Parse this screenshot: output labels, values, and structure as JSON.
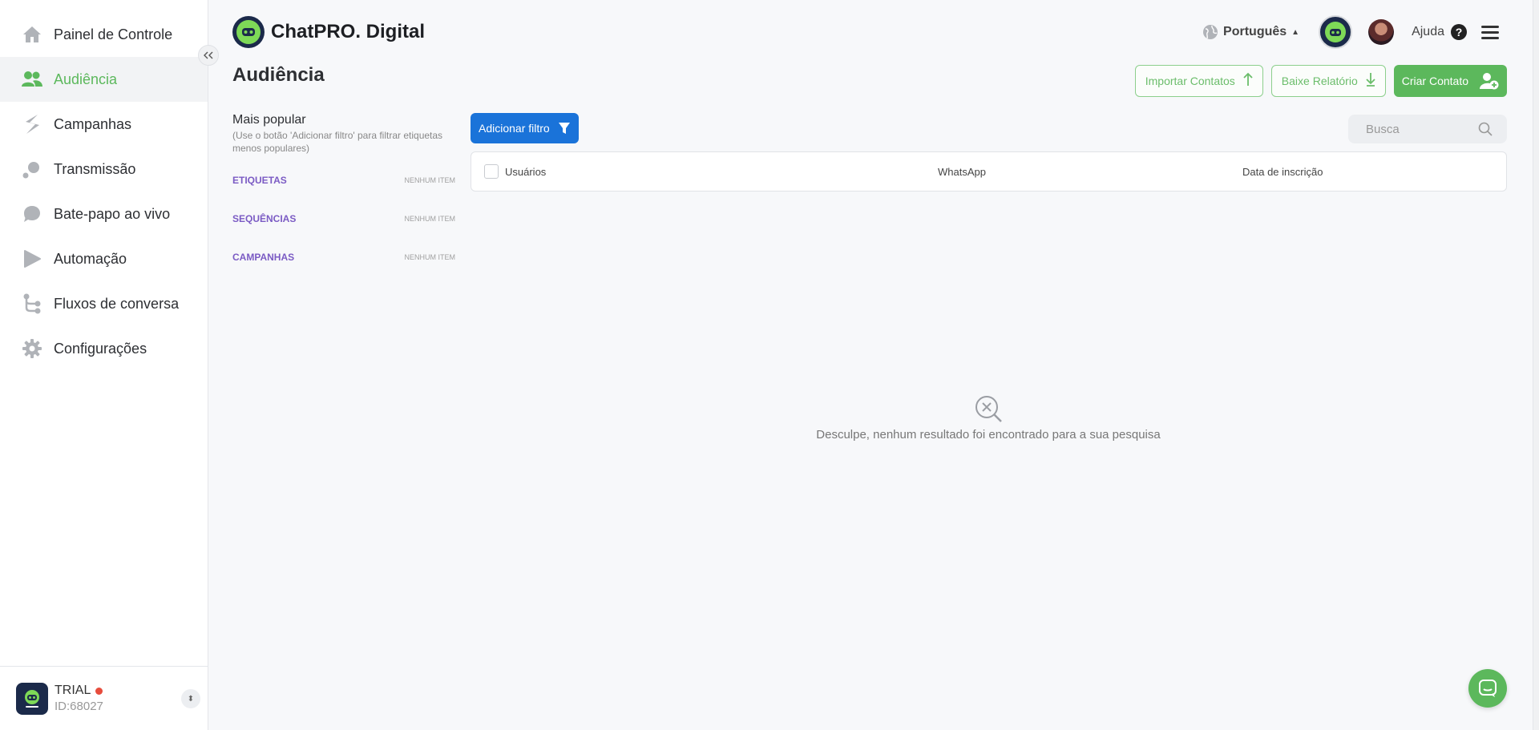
{
  "sidebar": {
    "items": [
      {
        "label": "Painel de Controle",
        "icon": "home-icon",
        "active": false
      },
      {
        "label": "Audiência",
        "icon": "users-icon",
        "active": true
      },
      {
        "label": "Campanhas",
        "icon": "campaign-icon",
        "active": false
      },
      {
        "label": "Transmissão",
        "icon": "broadcast-icon",
        "active": false
      },
      {
        "label": "Bate-papo ao vivo",
        "icon": "chat-icon",
        "active": false
      },
      {
        "label": "Automação",
        "icon": "automation-icon",
        "active": false
      },
      {
        "label": "Fluxos de conversa",
        "icon": "flow-icon",
        "active": false
      },
      {
        "label": "Configurações",
        "icon": "gear-icon",
        "active": false
      }
    ],
    "account": {
      "plan": "TRIAL",
      "id": "ID:68027"
    }
  },
  "header": {
    "brand": "ChatPRO. Digital",
    "language": "Português",
    "help": "Ajuda"
  },
  "page": {
    "title": "Audiência"
  },
  "actions": {
    "import": "Importar Contatos",
    "report": "Baixe Relatório",
    "create": "Criar Contato"
  },
  "filters": {
    "title": "Mais popular",
    "subtitle": "(Use o botão 'Adicionar filtro' para filtrar etiquetas menos populares)",
    "add_filter": "Adicionar filtro",
    "rows": [
      {
        "name": "ETIQUETAS",
        "count": "NENHUM ITEM"
      },
      {
        "name": "SEQUÊNCIAS",
        "count": "NENHUM ITEM"
      },
      {
        "name": "CAMPANHAS",
        "count": "NENHUM ITEM"
      }
    ]
  },
  "search": {
    "placeholder": "Busca"
  },
  "table": {
    "columns": [
      "Usuários",
      "WhatsApp",
      "Data de inscrição"
    ]
  },
  "empty_state": {
    "message": "Desculpe, nenhum resultado foi encontrado para a sua pesquisa"
  },
  "colors": {
    "accent": "#5cb85c",
    "primary_blue": "#1a73d9",
    "purple": "#7b5bc4"
  }
}
